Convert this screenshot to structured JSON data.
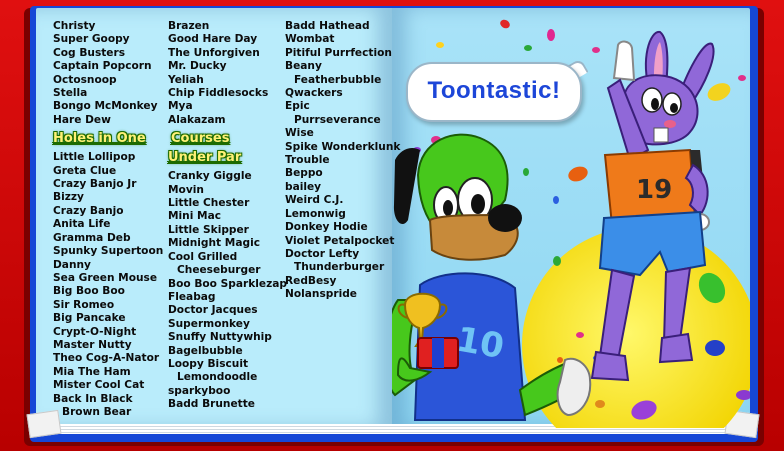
{
  "credits": {
    "column1": [
      {
        "text": "Christy"
      },
      {
        "text": "Super Goopy"
      },
      {
        "text": "Cog Busters"
      },
      {
        "text": "Captain Popcorn"
      },
      {
        "text": "Octosnoop"
      },
      {
        "text": "Stella"
      },
      {
        "text": "Bongo McMonkey"
      },
      {
        "text": "Hare Dew"
      }
    ],
    "holes_heading": "Holes in One",
    "column1b": [
      {
        "text": "Little Lollipop"
      },
      {
        "text": "Greta Clue"
      },
      {
        "text": "Crazy Banjo Jr"
      },
      {
        "text": "Bizzy"
      },
      {
        "text": "Crazy Banjo"
      },
      {
        "text": "Anita Life"
      },
      {
        "text": "Gramma  Deb"
      },
      {
        "text": "Spunky Supertoon"
      },
      {
        "text": "Danny"
      },
      {
        "text": "Sea Green Mouse"
      },
      {
        "text": "Big Boo Boo"
      },
      {
        "text": "Sir Romeo"
      },
      {
        "text": "Big Pancake"
      },
      {
        "text": "Crypt-O-Night"
      },
      {
        "text": "Master Nutty"
      },
      {
        "text": "Theo Cog-A-Nator"
      },
      {
        "text": "Mia The Ham"
      },
      {
        "text": "Mister Cool Cat"
      },
      {
        "text": "Back In Black"
      },
      {
        "text": "Brown Bear",
        "indent": true
      }
    ],
    "column2": [
      {
        "text": "Brazen"
      },
      {
        "text": "Good Hare Day"
      },
      {
        "text": "The Unforgiven"
      },
      {
        "text": "Mr. Ducky"
      },
      {
        "text": "Yeliah"
      },
      {
        "text": "Chip Fiddlesocks"
      },
      {
        "text": "Mya"
      },
      {
        "text": "Alakazam"
      }
    ],
    "courses_heading_line1": "Courses",
    "courses_heading_line2": "Under Par",
    "column2b": [
      {
        "text": "Cranky Giggle"
      },
      {
        "text": "Movin"
      },
      {
        "text": "Little Chester"
      },
      {
        "text": "Mini Mac"
      },
      {
        "text": "Little Skipper"
      },
      {
        "text": "Midnight Magic"
      },
      {
        "text": "Cool Grilled"
      },
      {
        "text": "Cheeseburger",
        "indent": true
      },
      {
        "text": "Boo Boo Sparklezap"
      },
      {
        "text": "Fleabag"
      },
      {
        "text": "Doctor Jacques"
      },
      {
        "text": "Supermonkey"
      },
      {
        "text": "Snuffy Nuttywhip"
      },
      {
        "text": "Bagelbubble"
      },
      {
        "text": "Loopy Biscuit"
      },
      {
        "text": "Lemondoodle",
        "indent": true
      },
      {
        "text": "sparkyboo"
      },
      {
        "text": "Badd Brunette"
      }
    ],
    "column3": [
      {
        "text": "Badd Hathead"
      },
      {
        "text": "Wombat"
      },
      {
        "text": "Pitiful Purrfection"
      },
      {
        "text": "Beany"
      },
      {
        "text": "Featherbubble",
        "indent": true
      },
      {
        "text": "Qwackers"
      },
      {
        "text": "Epic"
      },
      {
        "text": "Purrseverance",
        "indent": true
      },
      {
        "text": "Wise"
      },
      {
        "text": "Spike Wonderklunk"
      },
      {
        "text": "Trouble"
      },
      {
        "text": "Beppo"
      },
      {
        "text": "bailey"
      },
      {
        "text": "Weird C.J."
      },
      {
        "text": "Lemonwig"
      },
      {
        "text": "Donkey Hodie"
      },
      {
        "text": "Violet Petalpocket"
      },
      {
        "text": "Doctor Lefty"
      },
      {
        "text": "Thunderburger",
        "indent": true
      },
      {
        "text": "RedBesy"
      },
      {
        "text": "Nolanspride"
      }
    ]
  },
  "speech_bubble": "Toontastic!",
  "rabbit_shirt_number": "19",
  "dog_shirt_number": "10",
  "colors": {
    "book_cover": "#1647d6",
    "page": "#b9ecfb",
    "heading_fill": "#fff176",
    "heading_outline": "#1d6b00",
    "bubble_text": "#1d46d8",
    "background_red": "#d90a0a"
  },
  "icons": {
    "trophy": "trophy-icon",
    "jellybean": "jellybean-icon"
  }
}
